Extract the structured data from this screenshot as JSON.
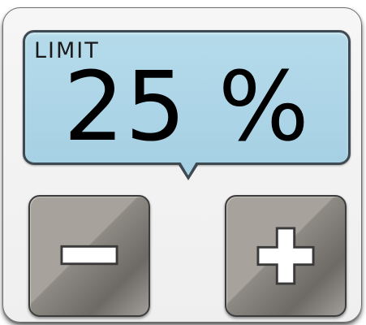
{
  "display": {
    "label": "LIMIT",
    "value": "25 %"
  },
  "buttons": {
    "decrease_icon": "minus-icon",
    "increase_icon": "plus-icon"
  },
  "colors": {
    "display_bg": "#aed6e8",
    "button_bg": "#a7a39c",
    "frame_border": "#6f6f6f"
  }
}
